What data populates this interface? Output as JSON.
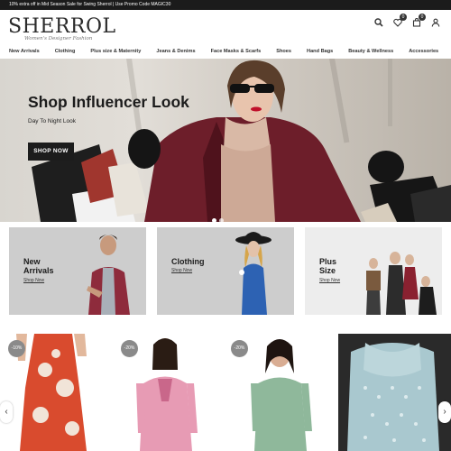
{
  "promo": {
    "text": "10% extra off in Mid Season Sale for Swing Sherrol | Use Promo Code MAGIC30"
  },
  "brand": {
    "name": "SHERROL",
    "tagline": "Women's Designer Fashion"
  },
  "header": {
    "icons": [
      "search-icon",
      "heart-icon",
      "cart-icon",
      "user-icon"
    ],
    "wishlist_count": "0",
    "cart_count": "0"
  },
  "nav": {
    "items": [
      {
        "label": "New Arrivals"
      },
      {
        "label": "Clothing"
      },
      {
        "label": "Plus size & Maternity"
      },
      {
        "label": "Jeans & Denims"
      },
      {
        "label": "Face Masks & Scarfs"
      },
      {
        "label": "Shoes"
      },
      {
        "label": "Hand Bags"
      },
      {
        "label": "Beauty & Wellness"
      },
      {
        "label": "Accessories"
      }
    ]
  },
  "hero": {
    "title": "Shop Influencer Look",
    "subtitle": "Day To Night Look",
    "cta": "SHOP NOW"
  },
  "categories": [
    {
      "title_line1": "New",
      "title_line2": "Arrivals",
      "link": "Shop Now"
    },
    {
      "title_line1": "Clothing",
      "title_line2": "",
      "link": "Shop Now"
    },
    {
      "title_line1": "Plus",
      "title_line2": "Size",
      "link": "Shop Now"
    }
  ],
  "products": [
    {
      "discount": "-10%",
      "color": "#d94b2e"
    },
    {
      "discount": "-20%",
      "color": "#e79bb4"
    },
    {
      "discount": "-20%",
      "color": "#8fb89b"
    },
    {
      "discount": "",
      "color": "#a9c8cf"
    }
  ],
  "carousel": {
    "prev_icon": "chevron-left-icon",
    "next_icon": "chevron-right-icon",
    "prev": "‹",
    "next": "›"
  }
}
